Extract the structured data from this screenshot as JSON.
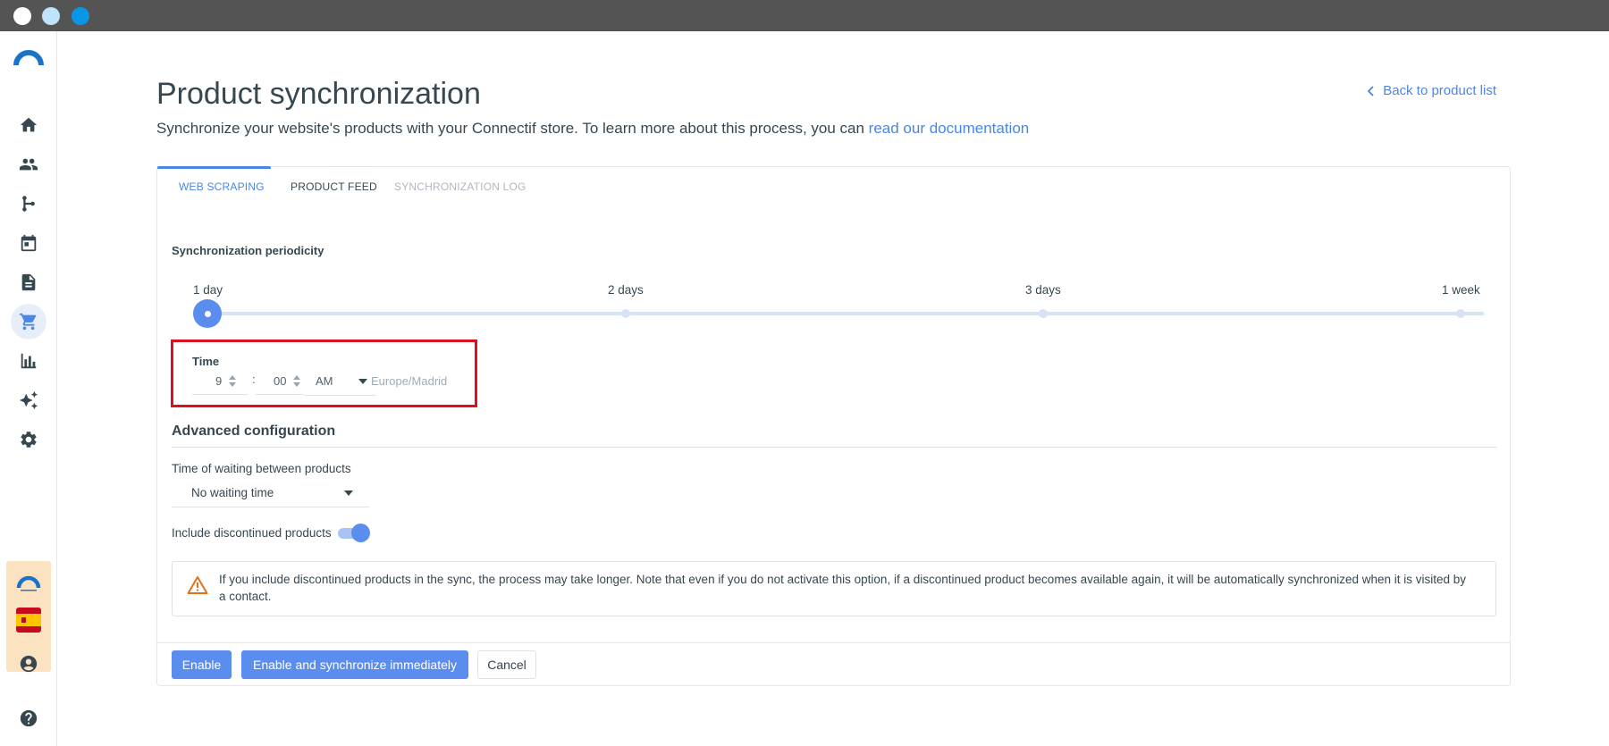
{
  "window": {
    "controls": [
      "close",
      "minimize",
      "maximize"
    ]
  },
  "sidebar": {
    "logo_icon": "connectif-logo-icon",
    "items": [
      {
        "name": "home",
        "icon": "home-icon"
      },
      {
        "name": "contacts",
        "icon": "people-icon"
      },
      {
        "name": "workflows",
        "icon": "workflow-icon"
      },
      {
        "name": "calendar",
        "icon": "calendar-icon"
      },
      {
        "name": "content",
        "icon": "document-icon"
      },
      {
        "name": "store",
        "icon": "cart-icon",
        "active": true
      },
      {
        "name": "reports",
        "icon": "bar-chart-icon"
      },
      {
        "name": "ai",
        "icon": "sparkles-icon"
      },
      {
        "name": "settings",
        "icon": "gear-icon"
      }
    ],
    "account_flag": "spain-flag",
    "bottom": [
      {
        "name": "profile",
        "icon": "user-circle-icon"
      },
      {
        "name": "help",
        "icon": "help-icon"
      }
    ]
  },
  "header": {
    "title": "Product synchronization",
    "subtitle": "Synchronize your website's products with your Connectif store. To learn more about this process, you can ",
    "doc_link": "read our documentation",
    "back_link": "Back to product list"
  },
  "tabs": [
    {
      "label": "WEB SCRAPING",
      "state": "active"
    },
    {
      "label": "PRODUCT FEED",
      "state": "normal"
    },
    {
      "label": "SYNCHRONIZATION LOG",
      "state": "disabled"
    }
  ],
  "periodicity": {
    "label": "Synchronization periodicity",
    "options": [
      "1 day",
      "2 days",
      "3 days",
      "1 week"
    ],
    "selected": "1 day"
  },
  "time": {
    "label": "Time",
    "hour": "9",
    "separator": ":",
    "minute": "00",
    "meridiem": "AM",
    "timezone": "Europe/Madrid"
  },
  "advanced": {
    "title": "Advanced configuration",
    "waiting_label": "Time of waiting between products",
    "waiting_value": "No waiting time",
    "discontinued_label": "Include discontinued products",
    "discontinued_enabled": true,
    "warning": "If you include discontinued products in the sync, the process may take longer. Note that even if you do not activate this option, if a discontinued product becomes available again, it will be automatically synchronized when it is visited by a contact."
  },
  "actions": {
    "enable": "Enable",
    "enable_sync": "Enable and synchronize immediately",
    "cancel": "Cancel"
  },
  "colors": {
    "accent": "#4a86e8",
    "primary_button": "#5b8def",
    "highlight_box": "#d9121f",
    "warning_icon": "#e0721c"
  }
}
